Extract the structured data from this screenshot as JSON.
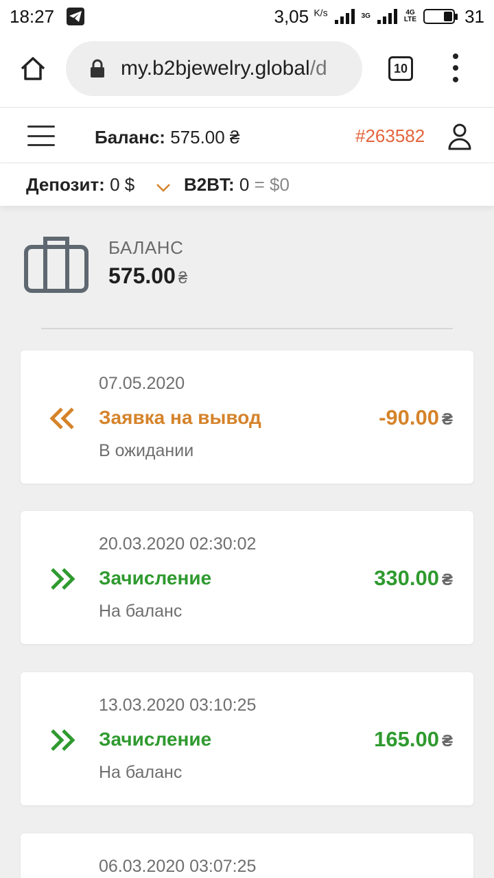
{
  "status_bar": {
    "time": "18:27",
    "speed": "3,05",
    "speed_unit": "K/s",
    "net_3g": "3G",
    "net_4g": "4G",
    "net_lte": "LTE",
    "battery": "31",
    "battery_level": 0.31
  },
  "browser": {
    "url_main": "my.b2bjewelry.global",
    "url_rest": "/d",
    "tab_count": "10"
  },
  "header": {
    "balance_label": "Баланс:",
    "balance_value": "575.00 ₴",
    "user_id": "#263582",
    "user_id_color": "#e3643c"
  },
  "subheader": {
    "deposit_label": "Депозит:",
    "deposit_value": "0 $",
    "b2bt_label": "B2BT:",
    "b2bt_value": "0",
    "b2bt_eq": "=",
    "b2bt_usd": "$0"
  },
  "balance": {
    "label": "БАЛАНС",
    "value": "575.00",
    "currency": "₴"
  },
  "colors": {
    "withdraw": "#d5832a",
    "credit": "#2f9a2f"
  },
  "transactions": [
    {
      "date": "07.05.2020",
      "title": "Заявка на вывод",
      "status": "В ожидании",
      "amount": "-90.00",
      "currency": "₴",
      "type": "withdraw"
    },
    {
      "date": "20.03.2020 02:30:02",
      "title": "Зачисление",
      "status": "На баланс",
      "amount": "330.00",
      "currency": "₴",
      "type": "credit"
    },
    {
      "date": "13.03.2020 03:10:25",
      "title": "Зачисление",
      "status": "На баланс",
      "amount": "165.00",
      "currency": "₴",
      "type": "credit"
    },
    {
      "date": "06.03.2020 03:07:25"
    }
  ]
}
